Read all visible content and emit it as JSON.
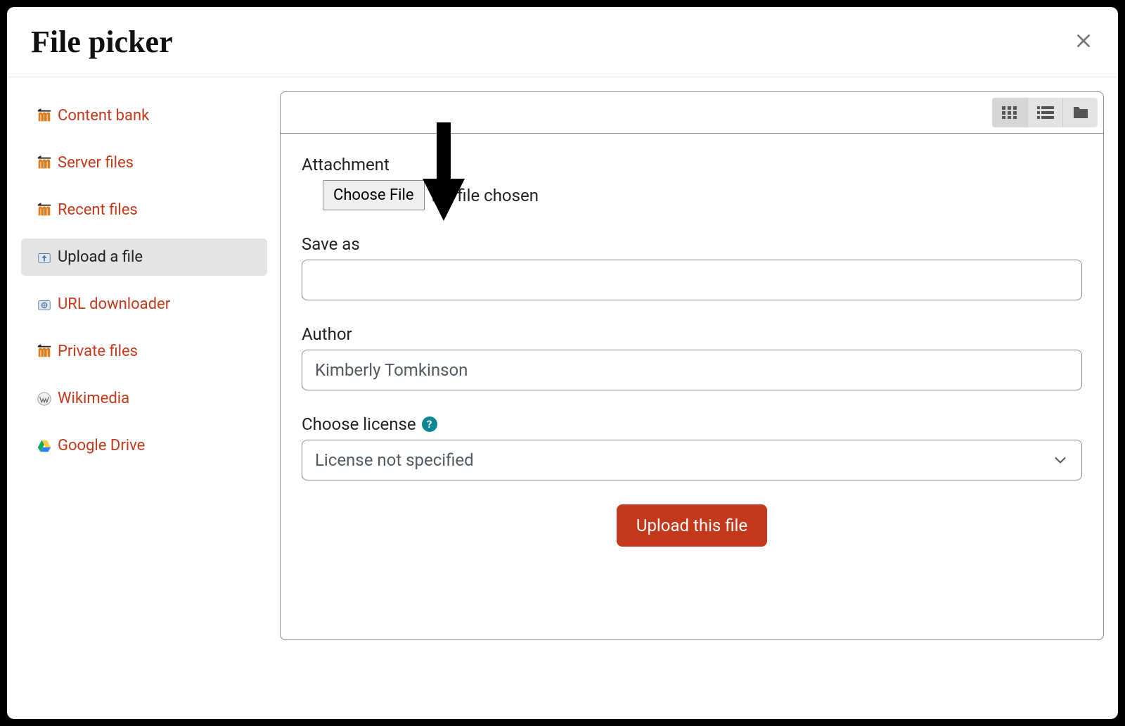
{
  "dialog": {
    "title": "File picker"
  },
  "sidebar": {
    "items": [
      {
        "label": "Content bank",
        "icon": "moodle"
      },
      {
        "label": "Server files",
        "icon": "moodle"
      },
      {
        "label": "Recent files",
        "icon": "moodle"
      },
      {
        "label": "Upload a file",
        "icon": "upload"
      },
      {
        "label": "URL downloader",
        "icon": "url"
      },
      {
        "label": "Private files",
        "icon": "moodle"
      },
      {
        "label": "Wikimedia",
        "icon": "wiki"
      },
      {
        "label": "Google Drive",
        "icon": "gdrive"
      }
    ],
    "active_index": 3
  },
  "form": {
    "attachment_label": "Attachment",
    "choose_file_label": "Choose File",
    "no_file_text": "No file chosen",
    "save_as_label": "Save as",
    "save_as_value": "",
    "author_label": "Author",
    "author_value": "Kimberly Tomkinson",
    "license_label": "Choose license",
    "license_selected": "License not specified",
    "upload_button": "Upload this file"
  }
}
